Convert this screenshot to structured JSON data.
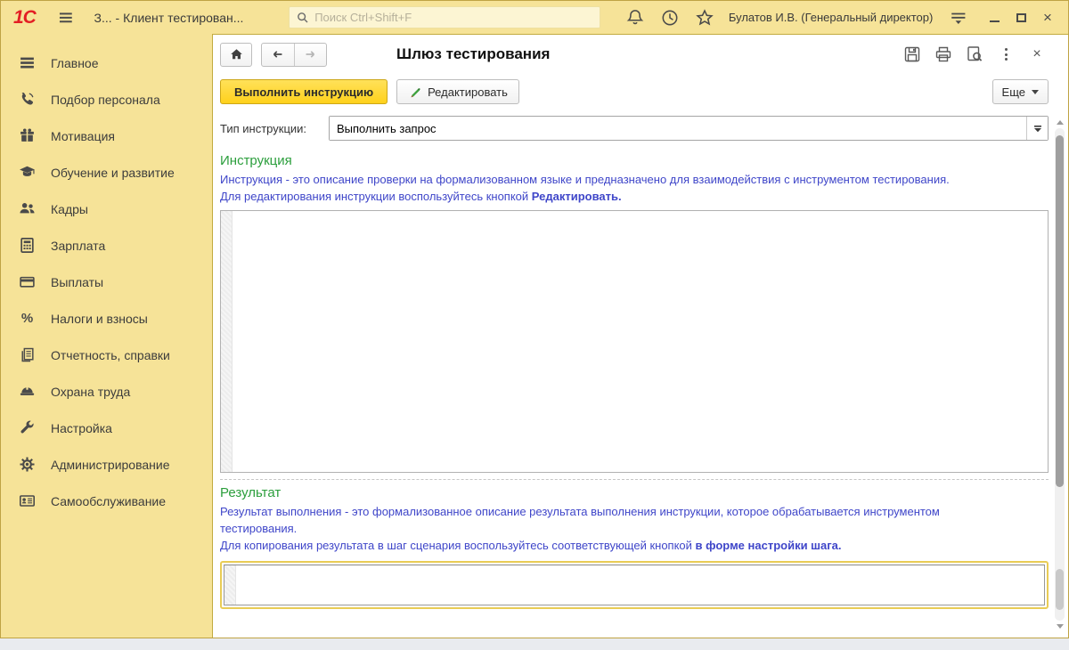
{
  "titlebar": {
    "logo": "1С",
    "title": "З...  - Клиент тестирован...",
    "search_placeholder": "Поиск Ctrl+Shift+F",
    "user": "Булатов И.В. (Генеральный директор)"
  },
  "sidebar": {
    "items": [
      {
        "id": "main",
        "icon": "menu",
        "label": "Главное"
      },
      {
        "id": "recruiting",
        "icon": "phone",
        "label": "Подбор персонала"
      },
      {
        "id": "motivation",
        "icon": "gift",
        "label": "Мотивация"
      },
      {
        "id": "training",
        "icon": "graduation",
        "label": "Обучение и развитие"
      },
      {
        "id": "hr",
        "icon": "people",
        "label": "Кадры"
      },
      {
        "id": "salary",
        "icon": "calculator",
        "label": "Зарплата"
      },
      {
        "id": "payments",
        "icon": "card",
        "label": "Выплаты"
      },
      {
        "id": "taxes",
        "icon": "percent",
        "label": "Налоги и взносы"
      },
      {
        "id": "reports",
        "icon": "documents",
        "label": "Отчетность, справки"
      },
      {
        "id": "labor-safety",
        "icon": "helmet",
        "label": "Охрана труда"
      },
      {
        "id": "settings",
        "icon": "wrench",
        "label": "Настройка"
      },
      {
        "id": "administration",
        "icon": "gear",
        "label": "Администрирование"
      },
      {
        "id": "self-service",
        "icon": "idcard",
        "label": "Самообслуживание"
      }
    ]
  },
  "form": {
    "title": "Шлюз тестирования",
    "toolbar": {
      "run_label": "Выполнить инструкцию",
      "edit_label": "Редактировать",
      "more_label": "Еще"
    },
    "type_row": {
      "label": "Тип инструкции:",
      "value": "Выполнить запрос"
    },
    "instruction": {
      "heading": "Инструкция",
      "desc1": "Инструкция - это описание проверки на формализованном языке и предназначено для взаимодействия с инструментом тестирования.",
      "desc2_prefix": "Для редактирования инструкции воспользуйтесь кнопкой ",
      "desc2_bold": "Редактировать.",
      "editor_value": ""
    },
    "result": {
      "heading": "Результат",
      "desc1": "Результат выполнения  - это формализованное описание результата выполнения инструкции, которое обрабатывается инструментом тестирования.",
      "desc2_prefix": "Для копирования результата в шаг сценария воспользуйтесь соответствующей кнопкой ",
      "desc2_bold": "в форме настройки шага.",
      "editor_value": ""
    }
  },
  "colors": {
    "topbar_bg": "#f6e398",
    "primary_button_bg": "#ffd92e",
    "heading_green": "#2b9e3c",
    "note_blue": "#3f46c9",
    "logo_red": "#e31e24",
    "focus_ring": "#e9cc55"
  }
}
